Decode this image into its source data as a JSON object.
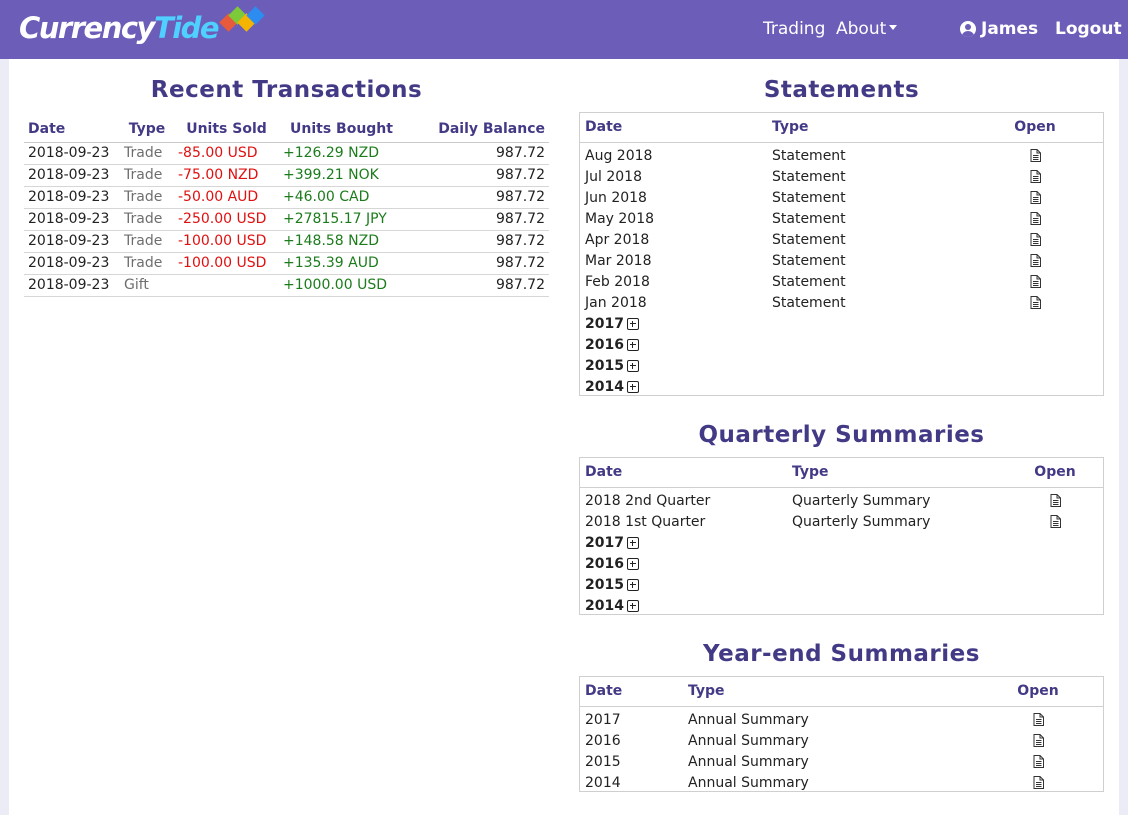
{
  "brand": {
    "part1": "Currency",
    "part2": "Tide"
  },
  "nav": {
    "trading": "Trading",
    "about": "About",
    "user": "James",
    "logout": "Logout"
  },
  "transactions": {
    "title": "Recent Transactions",
    "headers": [
      "Date",
      "Type",
      "Units Sold",
      "Units Bought",
      "Daily Balance"
    ],
    "rows": [
      {
        "date": "2018-09-23",
        "type": "Trade",
        "sold": "-85.00 USD",
        "bought": "+126.29 NZD",
        "balance": "987.72"
      },
      {
        "date": "2018-09-23",
        "type": "Trade",
        "sold": "-75.00 NZD",
        "bought": "+399.21 NOK",
        "balance": "987.72"
      },
      {
        "date": "2018-09-23",
        "type": "Trade",
        "sold": "-50.00 AUD",
        "bought": "+46.00 CAD",
        "balance": "987.72"
      },
      {
        "date": "2018-09-23",
        "type": "Trade",
        "sold": "-250.00 USD",
        "bought": "+27815.17 JPY",
        "balance": "987.72"
      },
      {
        "date": "2018-09-23",
        "type": "Trade",
        "sold": "-100.00 USD",
        "bought": "+148.58 NZD",
        "balance": "987.72"
      },
      {
        "date": "2018-09-23",
        "type": "Trade",
        "sold": "-100.00 USD",
        "bought": "+135.39 AUD",
        "balance": "987.72"
      },
      {
        "date": "2018-09-23",
        "type": "Gift",
        "sold": "",
        "bought": "+1000.00 USD",
        "balance": "987.72"
      }
    ]
  },
  "statements": {
    "title": "Statements",
    "headers": [
      "Date",
      "Type",
      "Open"
    ],
    "rows": [
      {
        "date": "Aug 2018",
        "type": "Statement"
      },
      {
        "date": "Jul 2018",
        "type": "Statement"
      },
      {
        "date": "Jun 2018",
        "type": "Statement"
      },
      {
        "date": "May 2018",
        "type": "Statement"
      },
      {
        "date": "Apr 2018",
        "type": "Statement"
      },
      {
        "date": "Mar 2018",
        "type": "Statement"
      },
      {
        "date": "Feb 2018",
        "type": "Statement"
      },
      {
        "date": "Jan 2018",
        "type": "Statement"
      }
    ],
    "years": [
      "2017",
      "2016",
      "2015",
      "2014"
    ]
  },
  "quarterly": {
    "title": "Quarterly Summaries",
    "headers": [
      "Date",
      "Type",
      "Open"
    ],
    "rows": [
      {
        "date": "2018 2nd Quarter",
        "type": "Quarterly Summary"
      },
      {
        "date": "2018 1st Quarter",
        "type": "Quarterly Summary"
      }
    ],
    "years": [
      "2017",
      "2016",
      "2015",
      "2014"
    ]
  },
  "yearend": {
    "title": "Year-end Summaries",
    "headers": [
      "Date",
      "Type",
      "Open"
    ],
    "rows": [
      {
        "date": "2017",
        "type": "Annual Summary"
      },
      {
        "date": "2016",
        "type": "Annual Summary"
      },
      {
        "date": "2015",
        "type": "Annual Summary"
      },
      {
        "date": "2014",
        "type": "Annual Summary"
      }
    ]
  },
  "colors": {
    "navbar": "#6b5db8",
    "heading": "#433a86",
    "negative": "#e01010",
    "positive": "#1c7c1c"
  },
  "icons": {
    "open": "document-icon",
    "expand": "plus-square-icon",
    "user": "user-circle-icon",
    "dropdown": "caret-down-icon"
  }
}
